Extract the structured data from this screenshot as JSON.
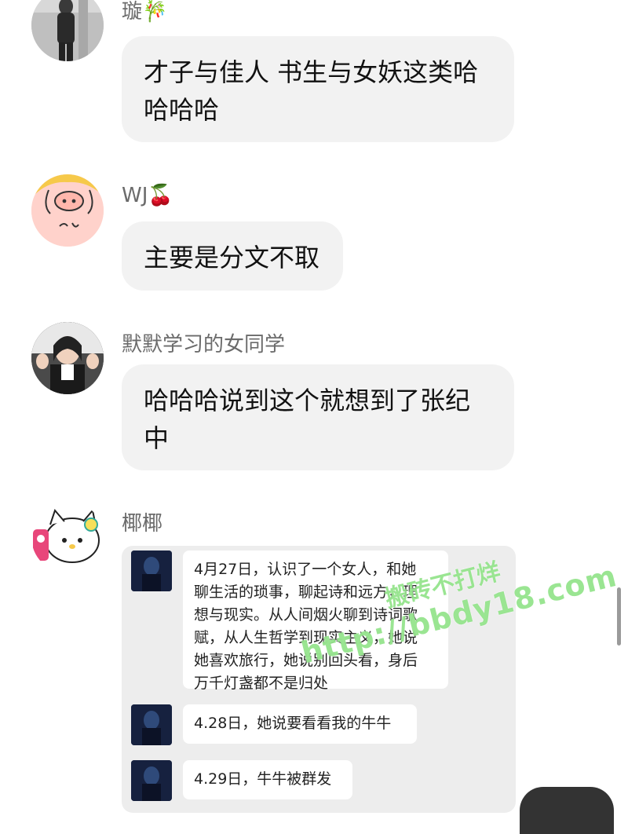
{
  "messages": [
    {
      "name": "璇",
      "emoji": "🎋",
      "lines": [
        "才子与佳人 书生与女妖这类哈",
        "哈哈哈"
      ]
    },
    {
      "name": "WJ",
      "emoji": "🍒",
      "lines": [
        "主要是分文不取"
      ]
    },
    {
      "name": "默默学习的女同学",
      "emoji": "",
      "lines": [
        "哈哈哈说到这个就想到了张纪",
        "中"
      ]
    },
    {
      "name": "椰椰",
      "emoji": "",
      "card": [
        {
          "text": "4月27日，认识了一个女人，和她\n聊生活的琐事，聊起诗和远方，理\n想与现实。从人间烟火聊到诗词歌\n赋，从人生哲学到现实主义，她说\n她喜欢旅行，她说别回头看，身后\n万千灯盏都不是归处"
        },
        {
          "text": "4.28日，她说要看看我的牛牛"
        },
        {
          "text": "4.29日，牛牛被群发"
        }
      ]
    }
  ],
  "watermark": {
    "line1": "搬砖不打烊",
    "line2": "http://bbdy18.com"
  },
  "colors": {
    "bubble": "#f2f2f2",
    "name": "#6b6b6b",
    "card": "#ededed",
    "watermark": "#78dc6e"
  },
  "icons": [
    "avatar-girl-photo",
    "avatar-pig-drawing",
    "avatar-girl-photo",
    "avatar-hello-kitty",
    "bamboo-emoji",
    "cherry-emoji"
  ]
}
